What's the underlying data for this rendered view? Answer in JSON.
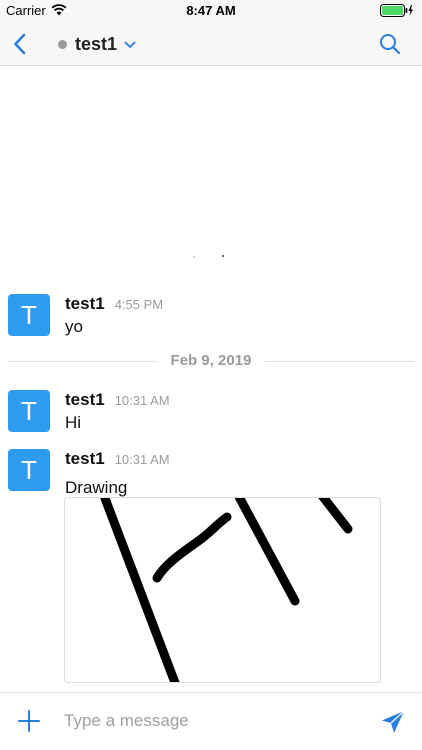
{
  "status_bar": {
    "carrier": "Carrier",
    "time": "8:47 AM"
  },
  "header": {
    "title": "test1",
    "presence_color": "#9b9b9b"
  },
  "messages": [
    {
      "avatar_letter": "T",
      "sender": "test1",
      "time": "4:55 PM",
      "text": "yo"
    },
    {
      "avatar_letter": "T",
      "sender": "test1",
      "time": "10:31 AM",
      "text": "Hi"
    },
    {
      "avatar_letter": "T",
      "sender": "test1",
      "time": "10:31 AM",
      "text": "Drawing",
      "attachment": "drawing-image"
    }
  ],
  "date_divider": "Feb 9, 2019",
  "composer": {
    "placeholder": "Type a message"
  },
  "colors": {
    "accent": "#2a7de1",
    "avatar": "#2d9cf0",
    "battery": "#4cd964"
  }
}
